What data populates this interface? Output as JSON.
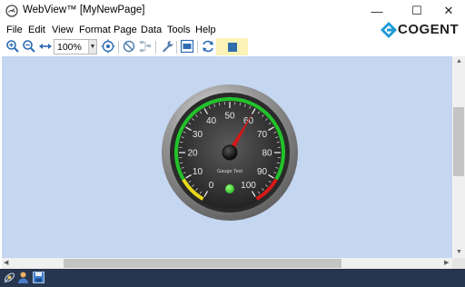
{
  "window": {
    "title": "WebView™ [MyNewPage]",
    "controls": {
      "minimize": "—",
      "maximize": "☐",
      "close": "✕"
    }
  },
  "menu": {
    "items": [
      "File",
      "Edit",
      "View",
      "Format",
      "Page",
      "Data",
      "Tools",
      "Help"
    ]
  },
  "toolbar": {
    "zoom_value": "100%",
    "icons": [
      "zoom-in-icon",
      "zoom-out-icon",
      "fit-width-icon",
      "zoom-dropdown",
      "target-icon",
      "no-entry-icon",
      "network-icon",
      "wrench-icon",
      "xml-icon",
      "refresh-icon",
      "stop-icon"
    ]
  },
  "brand": {
    "logo_text": "COGENT"
  },
  "gauge": {
    "label": "Gauge Text",
    "value": 60,
    "min": 0,
    "max": 100,
    "tick_labels": [
      "0",
      "10",
      "20",
      "30",
      "40",
      "50",
      "60",
      "70",
      "80",
      "90",
      "100"
    ],
    "indicator_color": "#3ec43e",
    "needle_color": "#d01818",
    "zones": {
      "low": "#e8d81c",
      "normal": "#22c22a",
      "high": "#d41a1a"
    }
  },
  "statusbar": {
    "icons": [
      "satellite-icon",
      "user-icon",
      "save-icon"
    ]
  }
}
